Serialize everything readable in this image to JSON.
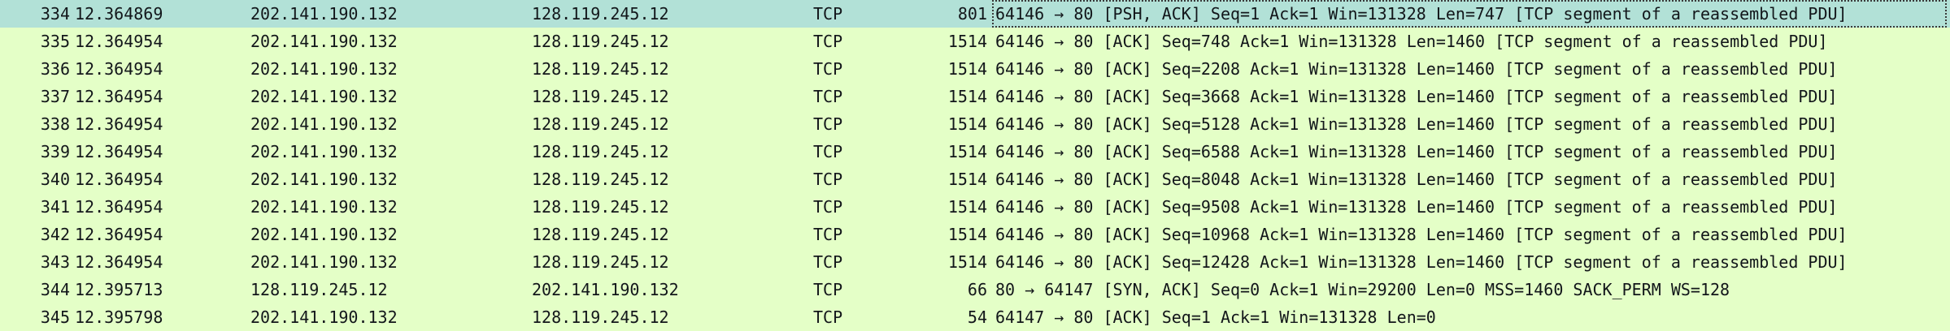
{
  "packets": [
    {
      "no": "334",
      "time": "12.364869",
      "source": "202.141.190.132",
      "destination": "128.119.245.12",
      "protocol": "TCP",
      "length": "801",
      "info": "64146 → 80 [PSH, ACK] Seq=1 Ack=1 Win=131328 Len=747 [TCP segment of a reassembled PDU]"
    },
    {
      "no": "335",
      "time": "12.364954",
      "source": "202.141.190.132",
      "destination": "128.119.245.12",
      "protocol": "TCP",
      "length": "1514",
      "info": "64146 → 80 [ACK] Seq=748 Ack=1 Win=131328 Len=1460 [TCP segment of a reassembled PDU]"
    },
    {
      "no": "336",
      "time": "12.364954",
      "source": "202.141.190.132",
      "destination": "128.119.245.12",
      "protocol": "TCP",
      "length": "1514",
      "info": "64146 → 80 [ACK] Seq=2208 Ack=1 Win=131328 Len=1460 [TCP segment of a reassembled PDU]"
    },
    {
      "no": "337",
      "time": "12.364954",
      "source": "202.141.190.132",
      "destination": "128.119.245.12",
      "protocol": "TCP",
      "length": "1514",
      "info": "64146 → 80 [ACK] Seq=3668 Ack=1 Win=131328 Len=1460 [TCP segment of a reassembled PDU]"
    },
    {
      "no": "338",
      "time": "12.364954",
      "source": "202.141.190.132",
      "destination": "128.119.245.12",
      "protocol": "TCP",
      "length": "1514",
      "info": "64146 → 80 [ACK] Seq=5128 Ack=1 Win=131328 Len=1460 [TCP segment of a reassembled PDU]"
    },
    {
      "no": "339",
      "time": "12.364954",
      "source": "202.141.190.132",
      "destination": "128.119.245.12",
      "protocol": "TCP",
      "length": "1514",
      "info": "64146 → 80 [ACK] Seq=6588 Ack=1 Win=131328 Len=1460 [TCP segment of a reassembled PDU]"
    },
    {
      "no": "340",
      "time": "12.364954",
      "source": "202.141.190.132",
      "destination": "128.119.245.12",
      "protocol": "TCP",
      "length": "1514",
      "info": "64146 → 80 [ACK] Seq=8048 Ack=1 Win=131328 Len=1460 [TCP segment of a reassembled PDU]"
    },
    {
      "no": "341",
      "time": "12.364954",
      "source": "202.141.190.132",
      "destination": "128.119.245.12",
      "protocol": "TCP",
      "length": "1514",
      "info": "64146 → 80 [ACK] Seq=9508 Ack=1 Win=131328 Len=1460 [TCP segment of a reassembled PDU]"
    },
    {
      "no": "342",
      "time": "12.364954",
      "source": "202.141.190.132",
      "destination": "128.119.245.12",
      "protocol": "TCP",
      "length": "1514",
      "info": "64146 → 80 [ACK] Seq=10968 Ack=1 Win=131328 Len=1460 [TCP segment of a reassembled PDU]"
    },
    {
      "no": "343",
      "time": "12.364954",
      "source": "202.141.190.132",
      "destination": "128.119.245.12",
      "protocol": "TCP",
      "length": "1514",
      "info": "64146 → 80 [ACK] Seq=12428 Ack=1 Win=131328 Len=1460 [TCP segment of a reassembled PDU]"
    },
    {
      "no": "344",
      "time": "12.395713",
      "source": "128.119.245.12",
      "destination": "202.141.190.132",
      "protocol": "TCP",
      "length": "66",
      "info": "80 → 64147 [SYN, ACK] Seq=0 Ack=1 Win=29200 Len=0 MSS=1460 SACK_PERM WS=128"
    },
    {
      "no": "345",
      "time": "12.395798",
      "source": "202.141.190.132",
      "destination": "128.119.245.12",
      "protocol": "TCP",
      "length": "54",
      "info": "64147 → 80 [ACK] Seq=1 Ack=1 Win=131328 Len=0"
    }
  ],
  "selected_row": "334",
  "colors": {
    "tcp_row_bg": "#e4ffc7",
    "selected_row_bg": "#b2e1d7",
    "text": "#12161a"
  }
}
